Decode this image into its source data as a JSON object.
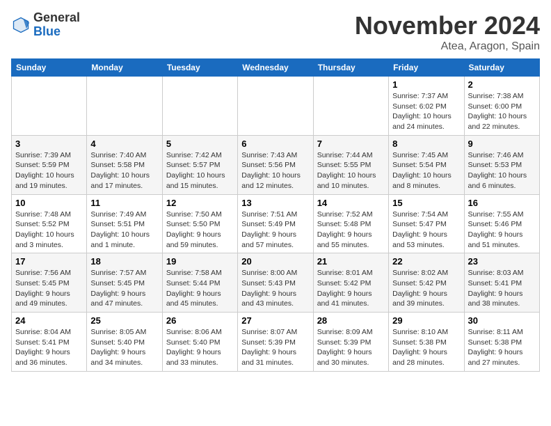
{
  "header": {
    "logo_general": "General",
    "logo_blue": "Blue",
    "month_title": "November 2024",
    "location": "Atea, Aragon, Spain"
  },
  "days_of_week": [
    "Sunday",
    "Monday",
    "Tuesday",
    "Wednesday",
    "Thursday",
    "Friday",
    "Saturday"
  ],
  "weeks": [
    [
      {
        "day": "",
        "info": ""
      },
      {
        "day": "",
        "info": ""
      },
      {
        "day": "",
        "info": ""
      },
      {
        "day": "",
        "info": ""
      },
      {
        "day": "",
        "info": ""
      },
      {
        "day": "1",
        "info": "Sunrise: 7:37 AM\nSunset: 6:02 PM\nDaylight: 10 hours and 24 minutes."
      },
      {
        "day": "2",
        "info": "Sunrise: 7:38 AM\nSunset: 6:00 PM\nDaylight: 10 hours and 22 minutes."
      }
    ],
    [
      {
        "day": "3",
        "info": "Sunrise: 7:39 AM\nSunset: 5:59 PM\nDaylight: 10 hours and 19 minutes."
      },
      {
        "day": "4",
        "info": "Sunrise: 7:40 AM\nSunset: 5:58 PM\nDaylight: 10 hours and 17 minutes."
      },
      {
        "day": "5",
        "info": "Sunrise: 7:42 AM\nSunset: 5:57 PM\nDaylight: 10 hours and 15 minutes."
      },
      {
        "day": "6",
        "info": "Sunrise: 7:43 AM\nSunset: 5:56 PM\nDaylight: 10 hours and 12 minutes."
      },
      {
        "day": "7",
        "info": "Sunrise: 7:44 AM\nSunset: 5:55 PM\nDaylight: 10 hours and 10 minutes."
      },
      {
        "day": "8",
        "info": "Sunrise: 7:45 AM\nSunset: 5:54 PM\nDaylight: 10 hours and 8 minutes."
      },
      {
        "day": "9",
        "info": "Sunrise: 7:46 AM\nSunset: 5:53 PM\nDaylight: 10 hours and 6 minutes."
      }
    ],
    [
      {
        "day": "10",
        "info": "Sunrise: 7:48 AM\nSunset: 5:52 PM\nDaylight: 10 hours and 3 minutes."
      },
      {
        "day": "11",
        "info": "Sunrise: 7:49 AM\nSunset: 5:51 PM\nDaylight: 10 hours and 1 minute."
      },
      {
        "day": "12",
        "info": "Sunrise: 7:50 AM\nSunset: 5:50 PM\nDaylight: 9 hours and 59 minutes."
      },
      {
        "day": "13",
        "info": "Sunrise: 7:51 AM\nSunset: 5:49 PM\nDaylight: 9 hours and 57 minutes."
      },
      {
        "day": "14",
        "info": "Sunrise: 7:52 AM\nSunset: 5:48 PM\nDaylight: 9 hours and 55 minutes."
      },
      {
        "day": "15",
        "info": "Sunrise: 7:54 AM\nSunset: 5:47 PM\nDaylight: 9 hours and 53 minutes."
      },
      {
        "day": "16",
        "info": "Sunrise: 7:55 AM\nSunset: 5:46 PM\nDaylight: 9 hours and 51 minutes."
      }
    ],
    [
      {
        "day": "17",
        "info": "Sunrise: 7:56 AM\nSunset: 5:45 PM\nDaylight: 9 hours and 49 minutes."
      },
      {
        "day": "18",
        "info": "Sunrise: 7:57 AM\nSunset: 5:45 PM\nDaylight: 9 hours and 47 minutes."
      },
      {
        "day": "19",
        "info": "Sunrise: 7:58 AM\nSunset: 5:44 PM\nDaylight: 9 hours and 45 minutes."
      },
      {
        "day": "20",
        "info": "Sunrise: 8:00 AM\nSunset: 5:43 PM\nDaylight: 9 hours and 43 minutes."
      },
      {
        "day": "21",
        "info": "Sunrise: 8:01 AM\nSunset: 5:42 PM\nDaylight: 9 hours and 41 minutes."
      },
      {
        "day": "22",
        "info": "Sunrise: 8:02 AM\nSunset: 5:42 PM\nDaylight: 9 hours and 39 minutes."
      },
      {
        "day": "23",
        "info": "Sunrise: 8:03 AM\nSunset: 5:41 PM\nDaylight: 9 hours and 38 minutes."
      }
    ],
    [
      {
        "day": "24",
        "info": "Sunrise: 8:04 AM\nSunset: 5:41 PM\nDaylight: 9 hours and 36 minutes."
      },
      {
        "day": "25",
        "info": "Sunrise: 8:05 AM\nSunset: 5:40 PM\nDaylight: 9 hours and 34 minutes."
      },
      {
        "day": "26",
        "info": "Sunrise: 8:06 AM\nSunset: 5:40 PM\nDaylight: 9 hours and 33 minutes."
      },
      {
        "day": "27",
        "info": "Sunrise: 8:07 AM\nSunset: 5:39 PM\nDaylight: 9 hours and 31 minutes."
      },
      {
        "day": "28",
        "info": "Sunrise: 8:09 AM\nSunset: 5:39 PM\nDaylight: 9 hours and 30 minutes."
      },
      {
        "day": "29",
        "info": "Sunrise: 8:10 AM\nSunset: 5:38 PM\nDaylight: 9 hours and 28 minutes."
      },
      {
        "day": "30",
        "info": "Sunrise: 8:11 AM\nSunset: 5:38 PM\nDaylight: 9 hours and 27 minutes."
      }
    ]
  ]
}
